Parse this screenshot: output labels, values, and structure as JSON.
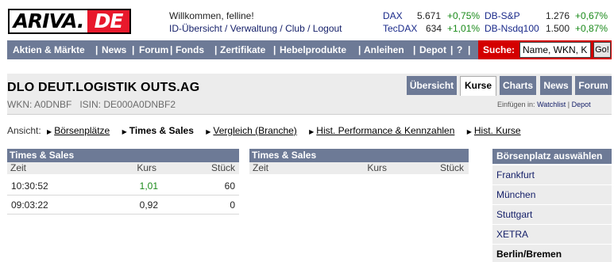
{
  "logo": {
    "part1": "ARIVA.",
    "part2": "DE"
  },
  "header": {
    "welcome": "Willkommen, felline!",
    "links": [
      "ID-Übersicht",
      "Verwaltung",
      "Club",
      "Logout"
    ],
    "link_sep": " / "
  },
  "indices": [
    {
      "name": "DAX",
      "value": "5.671",
      "change": "+0,75%"
    },
    {
      "name": "TecDAX",
      "value": "634",
      "change": "+1,01%"
    },
    {
      "name": "DB-S&P",
      "value": "1.276",
      "change": "+0,67%"
    },
    {
      "name": "DB-Nsdq100",
      "value": "1.500",
      "change": "+0,87%"
    }
  ],
  "nav": {
    "items": [
      "Aktien & Märkte",
      "News",
      "Forum",
      "Fonds",
      "Zertifikate",
      "Hebelprodukte",
      "Anleihen",
      "Depot",
      "?"
    ],
    "pipe": "|",
    "search_label": "Suche:",
    "search_value": "Name, WKN, K",
    "search_button": "Go!"
  },
  "security": {
    "title": "DLO DEUT.LOGISTIK OUTS.AG",
    "wkn_isin": "WKN: A0DNBF   ISIN: DE000A0DNBF2"
  },
  "tabs": [
    "Übersicht",
    "Kurse",
    "Charts",
    "News",
    "Forum"
  ],
  "watchlist": {
    "prefix": "Einfügen in:",
    "watchlist": "Watchlist",
    "sep": " | ",
    "depot": "Depot"
  },
  "ansicht": {
    "label": "Ansicht:",
    "items": [
      "Börsenplätze",
      "Times & Sales",
      "Vergleich (Branche)",
      "Hist. Performance & Kennzahlen",
      "Hist. Kurse"
    ]
  },
  "table_left": {
    "title": "Times & Sales",
    "columns": [
      "Zeit",
      "Kurs",
      "Stück"
    ],
    "rows": [
      {
        "zeit": "10:30:52",
        "kurs": "1,01",
        "stueck": "60"
      },
      {
        "zeit": "09:03:22",
        "kurs": "0,92",
        "stueck": "0"
      }
    ]
  },
  "table_right": {
    "title": "Times & Sales",
    "columns": [
      "Zeit",
      "Kurs",
      "Stück"
    ]
  },
  "sidebar": {
    "title": "Börsenplatz auswählen",
    "items": [
      "Frankfurt",
      "München",
      "Stuttgart",
      "XETRA",
      "Berlin/Bremen"
    ]
  },
  "colors": {
    "nav": "#6d7a96",
    "search": "#d40000",
    "positive": "#1a8a1a",
    "logo_red": "#e8192c"
  }
}
